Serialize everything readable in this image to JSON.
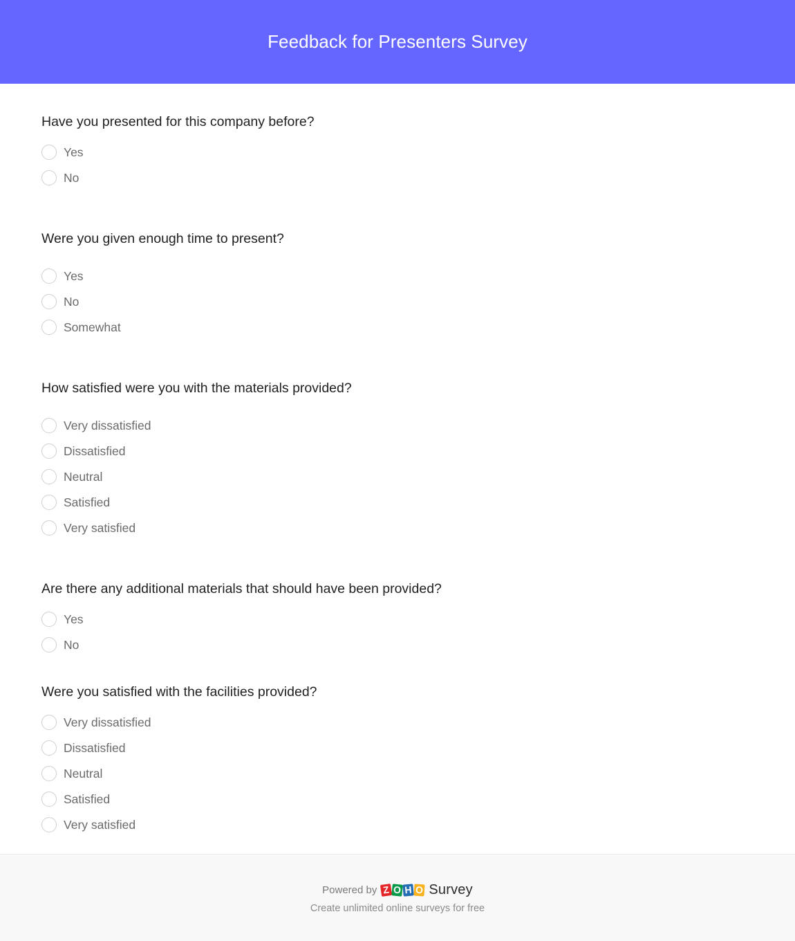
{
  "header": {
    "title": "Feedback for Presenters Survey",
    "background_color": "#6566ff"
  },
  "questions": [
    {
      "title": "Have you presented for this company before?",
      "options": [
        "Yes",
        "No"
      ]
    },
    {
      "title": "Were you given enough time to present?",
      "options": [
        "Yes",
        "No",
        "Somewhat"
      ]
    },
    {
      "title": "How satisfied were you with the materials provided?",
      "options": [
        "Very dissatisfied",
        "Dissatisfied",
        "Neutral",
        "Satisfied",
        "Very satisfied"
      ]
    },
    {
      "title": "Are there any additional materials that should have been provided?",
      "options": [
        "Yes",
        "No"
      ]
    },
    {
      "title": "Were you satisfied with the facilities provided?",
      "options": [
        "Very dissatisfied",
        "Dissatisfied",
        "Neutral",
        "Satisfied",
        "Very satisfied"
      ]
    }
  ],
  "footer": {
    "powered_by": "Powered by",
    "brand_letters": [
      "Z",
      "O",
      "H",
      "O"
    ],
    "brand_colors": [
      "#e42527",
      "#089949",
      "#226db4",
      "#f9b21d"
    ],
    "product": "Survey",
    "tagline": "Create unlimited online surveys for free"
  }
}
